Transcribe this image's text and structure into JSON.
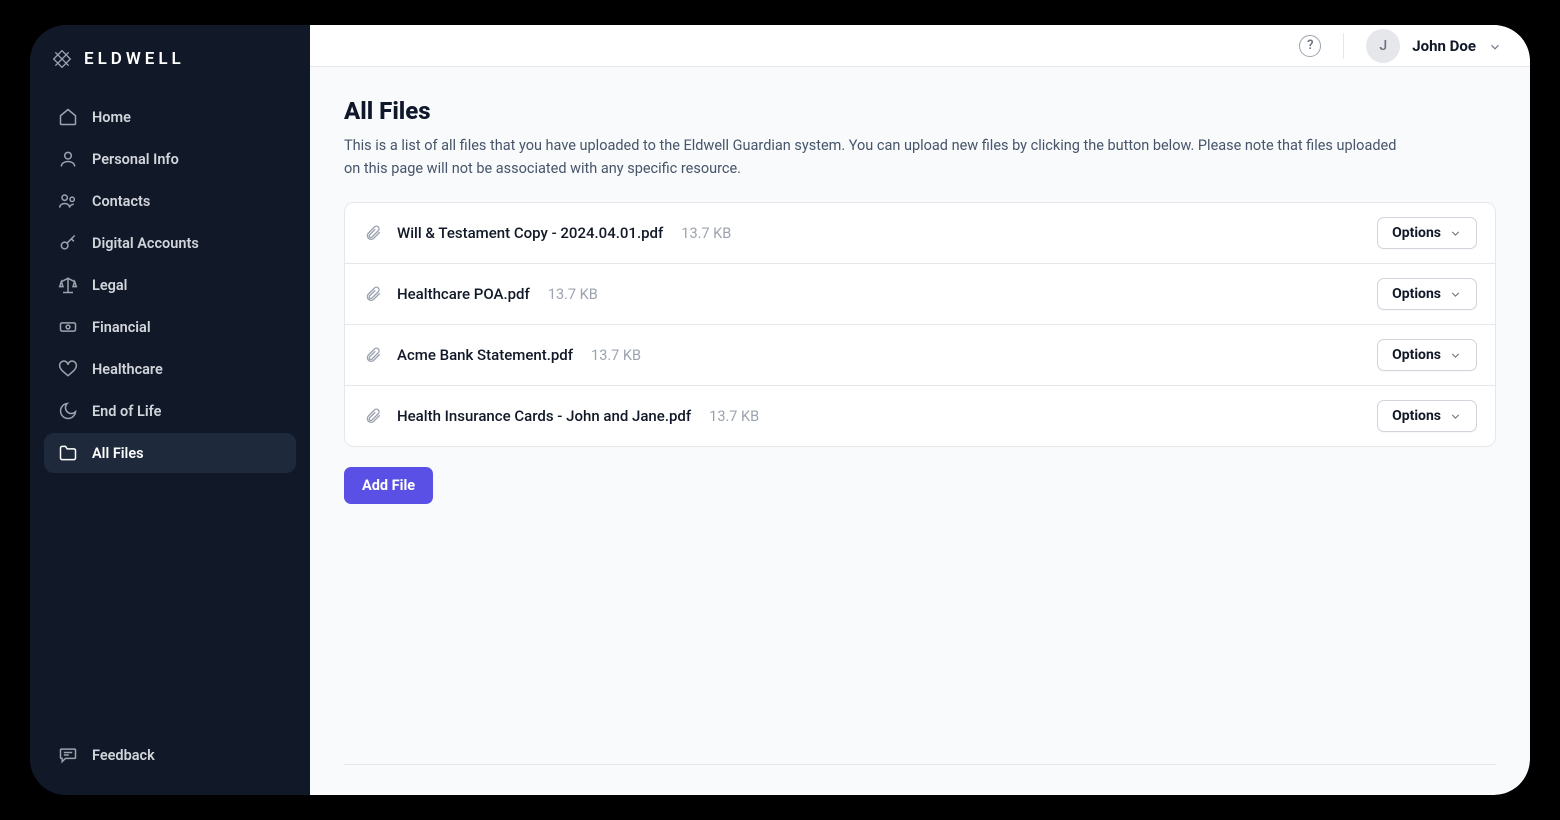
{
  "brand": "ELDWELL",
  "sidebar": {
    "items": [
      {
        "label": "Home",
        "icon": "home-icon"
      },
      {
        "label": "Personal Info",
        "icon": "user-icon"
      },
      {
        "label": "Contacts",
        "icon": "users-icon"
      },
      {
        "label": "Digital Accounts",
        "icon": "key-icon"
      },
      {
        "label": "Legal",
        "icon": "scale-icon"
      },
      {
        "label": "Financial",
        "icon": "banknote-icon"
      },
      {
        "label": "Healthcare",
        "icon": "heart-icon"
      },
      {
        "label": "End of Life",
        "icon": "moon-icon"
      },
      {
        "label": "All Files",
        "icon": "folder-icon",
        "active": true
      }
    ],
    "feedback": "Feedback"
  },
  "header": {
    "help": "?",
    "user_initial": "J",
    "user_name": "John Doe"
  },
  "page": {
    "title": "All Files",
    "description": "This is a list of all files that you have uploaded to the Eldwell Guardian system. You can upload new files by clicking the button below. Please note that files uploaded on this page will not be associated with any specific resource.",
    "add_file_label": "Add File",
    "options_label": "Options"
  },
  "files": [
    {
      "name": "Will & Testament Copy - 2024.04.01.pdf",
      "size": "13.7 KB"
    },
    {
      "name": "Healthcare POA.pdf",
      "size": "13.7 KB"
    },
    {
      "name": "Acme Bank Statement.pdf",
      "size": "13.7 KB"
    },
    {
      "name": "Health Insurance Cards - John and Jane.pdf",
      "size": "13.7 KB"
    }
  ]
}
